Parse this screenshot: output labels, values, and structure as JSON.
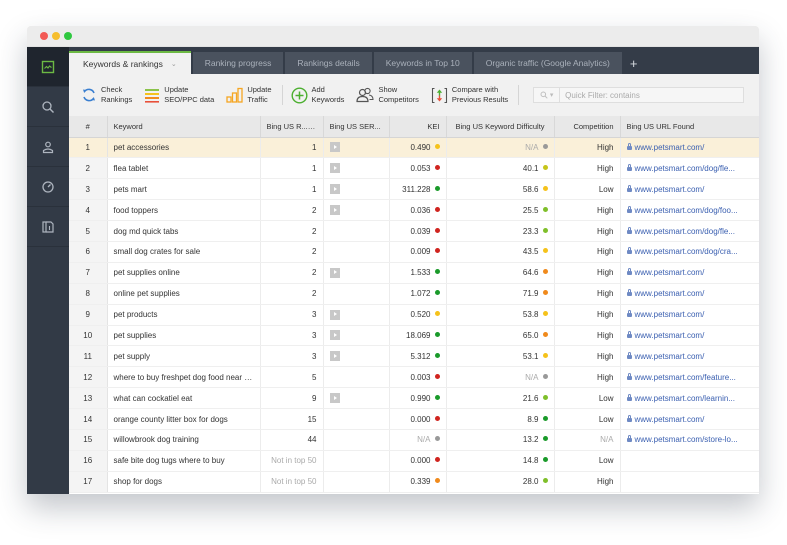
{
  "colors": {
    "accent": "#6cb944",
    "dot_red": "#d0241f",
    "dot_orange": "#f08a1c",
    "dot_yellow": "#f5c21b",
    "dot_yellowgreen": "#c6c51a",
    "dot_lightgreen": "#7fbf2a",
    "dot_green": "#1a9a2a",
    "dot_gray": "#999999"
  },
  "sidebar": {
    "items": [
      {
        "icon": "rankings-chart-icon",
        "active": true
      },
      {
        "icon": "search-icon",
        "active": false
      },
      {
        "icon": "user-icon",
        "active": false
      },
      {
        "icon": "speedometer-icon",
        "active": false
      },
      {
        "icon": "report-icon",
        "active": false
      }
    ]
  },
  "tabs": [
    {
      "label": "Keywords & rankings",
      "active": true
    },
    {
      "label": "Ranking progress",
      "active": false
    },
    {
      "label": "Rankings details",
      "active": false
    },
    {
      "label": "Keywords in Top 10",
      "active": false
    },
    {
      "label": "Organic traffic (Google Analytics)",
      "active": false
    }
  ],
  "tab_add_label": "+",
  "toolbar": {
    "check_rankings": [
      "Check",
      "Rankings"
    ],
    "update_seo": [
      "Update",
      "SEO/PPC data"
    ],
    "update_traffic": [
      "Update",
      "Traffic"
    ],
    "add_keywords": [
      "Add",
      "Keywords"
    ],
    "show_competitors": [
      "Show",
      "Competitors"
    ],
    "compare": [
      "Compare with",
      "Previous Results"
    ],
    "filter_placeholder": "Quick Filter: contains"
  },
  "table": {
    "headers": {
      "num": "#",
      "keyword": "Keyword",
      "rank": "Bing US R...",
      "serp": "Bing US SER...",
      "kei": "KEI",
      "difficulty": "Bing US Keyword Difficulty",
      "competition": "Competition",
      "url": "Bing US URL Found"
    },
    "sorted_column": "rank",
    "rows": [
      {
        "num": "1",
        "keyword": "pet accessories",
        "rank": "1",
        "serp": true,
        "kei": "0.490",
        "kei_dot": "yellow",
        "diff": "N/A",
        "diff_dot": "gray",
        "comp": "High",
        "url": "www.petsmart.com/",
        "selected": true
      },
      {
        "num": "2",
        "keyword": "flea tablet",
        "rank": "1",
        "serp": true,
        "kei": "0.053",
        "kei_dot": "red",
        "diff": "40.1",
        "diff_dot": "yellowgreen",
        "comp": "High",
        "url": "www.petsmart.com/dog/fle..."
      },
      {
        "num": "3",
        "keyword": "pets mart",
        "rank": "1",
        "serp": true,
        "kei": "311.228",
        "kei_dot": "green",
        "diff": "58.6",
        "diff_dot": "yellow",
        "comp": "Low",
        "url": "www.petsmart.com/"
      },
      {
        "num": "4",
        "keyword": "food toppers",
        "rank": "2",
        "serp": true,
        "kei": "0.036",
        "kei_dot": "red",
        "diff": "25.5",
        "diff_dot": "lightgreen",
        "comp": "High",
        "url": "www.petsmart.com/dog/foo..."
      },
      {
        "num": "5",
        "keyword": "dog md quick tabs",
        "rank": "2",
        "serp": false,
        "kei": "0.039",
        "kei_dot": "red",
        "diff": "23.3",
        "diff_dot": "lightgreen",
        "comp": "High",
        "url": "www.petsmart.com/dog/fle..."
      },
      {
        "num": "6",
        "keyword": "small dog crates for sale",
        "rank": "2",
        "serp": false,
        "kei": "0.009",
        "kei_dot": "red",
        "diff": "43.5",
        "diff_dot": "yellow",
        "comp": "High",
        "url": "www.petsmart.com/dog/cra..."
      },
      {
        "num": "7",
        "keyword": "pet supplies online",
        "rank": "2",
        "serp": true,
        "kei": "1.533",
        "kei_dot": "green",
        "diff": "64.6",
        "diff_dot": "orange",
        "comp": "High",
        "url": "www.petsmart.com/"
      },
      {
        "num": "8",
        "keyword": "online pet supplies",
        "rank": "2",
        "serp": false,
        "kei": "1.072",
        "kei_dot": "green",
        "diff": "71.9",
        "diff_dot": "orange",
        "comp": "High",
        "url": "www.petsmart.com/"
      },
      {
        "num": "9",
        "keyword": "pet products",
        "rank": "3",
        "serp": true,
        "kei": "0.520",
        "kei_dot": "yellow",
        "diff": "53.8",
        "diff_dot": "yellow",
        "comp": "High",
        "url": "www.petsmart.com/"
      },
      {
        "num": "10",
        "keyword": "pet supplies",
        "rank": "3",
        "serp": true,
        "kei": "18.069",
        "kei_dot": "green",
        "diff": "65.0",
        "diff_dot": "orange",
        "comp": "High",
        "url": "www.petsmart.com/"
      },
      {
        "num": "11",
        "keyword": "pet supply",
        "rank": "3",
        "serp": true,
        "kei": "5.312",
        "kei_dot": "green",
        "diff": "53.1",
        "diff_dot": "yellow",
        "comp": "High",
        "url": "www.petsmart.com/"
      },
      {
        "num": "12",
        "keyword": "where to buy freshpet dog food near me",
        "rank": "5",
        "serp": false,
        "kei": "0.003",
        "kei_dot": "red",
        "diff": "N/A",
        "diff_dot": "gray",
        "comp": "High",
        "url": "www.petsmart.com/feature..."
      },
      {
        "num": "13",
        "keyword": "what can cockatiel eat",
        "rank": "9",
        "serp": true,
        "kei": "0.990",
        "kei_dot": "green",
        "diff": "21.6",
        "diff_dot": "lightgreen",
        "comp": "Low",
        "url": "www.petsmart.com/learnin..."
      },
      {
        "num": "14",
        "keyword": "orange county litter box for dogs",
        "rank": "15",
        "serp": false,
        "kei": "0.000",
        "kei_dot": "red",
        "diff": "8.9",
        "diff_dot": "green",
        "comp": "Low",
        "url": "www.petsmart.com/"
      },
      {
        "num": "15",
        "keyword": "willowbrook dog training",
        "rank": "44",
        "serp": false,
        "kei": "N/A",
        "kei_dot": "gray",
        "diff": "13.2",
        "diff_dot": "green",
        "comp": "N/A",
        "url": "www.petsmart.com/store-lo..."
      },
      {
        "num": "16",
        "keyword": "safe bite dog tugs where to buy",
        "rank": "Not in top 50",
        "serp": false,
        "kei": "0.000",
        "kei_dot": "red",
        "diff": "14.8",
        "diff_dot": "green",
        "comp": "Low",
        "url": ""
      },
      {
        "num": "17",
        "keyword": "shop for dogs",
        "rank": "Not in top 50",
        "serp": false,
        "kei": "0.339",
        "kei_dot": "orange",
        "diff": "28.0",
        "diff_dot": "lightgreen",
        "comp": "High",
        "url": ""
      }
    ]
  }
}
